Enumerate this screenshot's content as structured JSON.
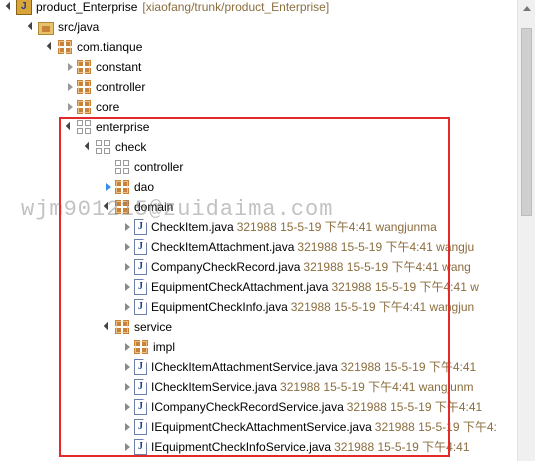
{
  "project": {
    "label": "product_Enterprise",
    "decoration": "[xiaofang/trunk/product_Enterprise]"
  },
  "src_folder": {
    "label": "src/java"
  },
  "root_package": {
    "label": "com.tianque"
  },
  "packages": [
    {
      "label": "constant"
    },
    {
      "label": "controller"
    },
    {
      "label": "core"
    },
    {
      "label": "enterprise"
    }
  ],
  "check": {
    "label": "check"
  },
  "check_children": [
    {
      "label": "controller"
    },
    {
      "label": "dao"
    },
    {
      "label": "domain"
    }
  ],
  "domain_files": [
    {
      "name": "CheckItem.java",
      "meta": "321988  15-5-19 下午4:41  wangjunma"
    },
    {
      "name": "CheckItemAttachment.java",
      "meta": "321988  15-5-19 下午4:41  wangju"
    },
    {
      "name": "CompanyCheckRecord.java",
      "meta": "321988  15-5-19 下午4:41  wang"
    },
    {
      "name": "EquipmentCheckAttachment.java",
      "meta": "321988  15-5-19 下午4:41  w"
    },
    {
      "name": "EquipmentCheckInfo.java",
      "meta": "321988  15-5-19 下午4:41  wangjun"
    }
  ],
  "service": {
    "label": "service"
  },
  "service_children": [
    {
      "label": "impl"
    }
  ],
  "service_files": [
    {
      "name": "ICheckItemAttachmentService.java",
      "meta": "321988  15-5-19 下午4:41"
    },
    {
      "name": "ICheckItemService.java",
      "meta": "321988  15-5-19 下午4:41  wangjunm"
    },
    {
      "name": "ICompanyCheckRecordService.java",
      "meta": "321988  15-5-19 下午4:41"
    },
    {
      "name": "IEquipmentCheckAttachmentService.java",
      "meta": "321988  15-5-19  下午4:"
    },
    {
      "name": "IEquipmentCheckInfoService.java",
      "meta": "321988  15-5-19 下午4:41"
    }
  ],
  "watermark": "wjm901215@zuidaima.com",
  "colors": {
    "highlight_box": "#e32a2a",
    "decoration": "#8b6d3e",
    "package": "#c9823a"
  }
}
